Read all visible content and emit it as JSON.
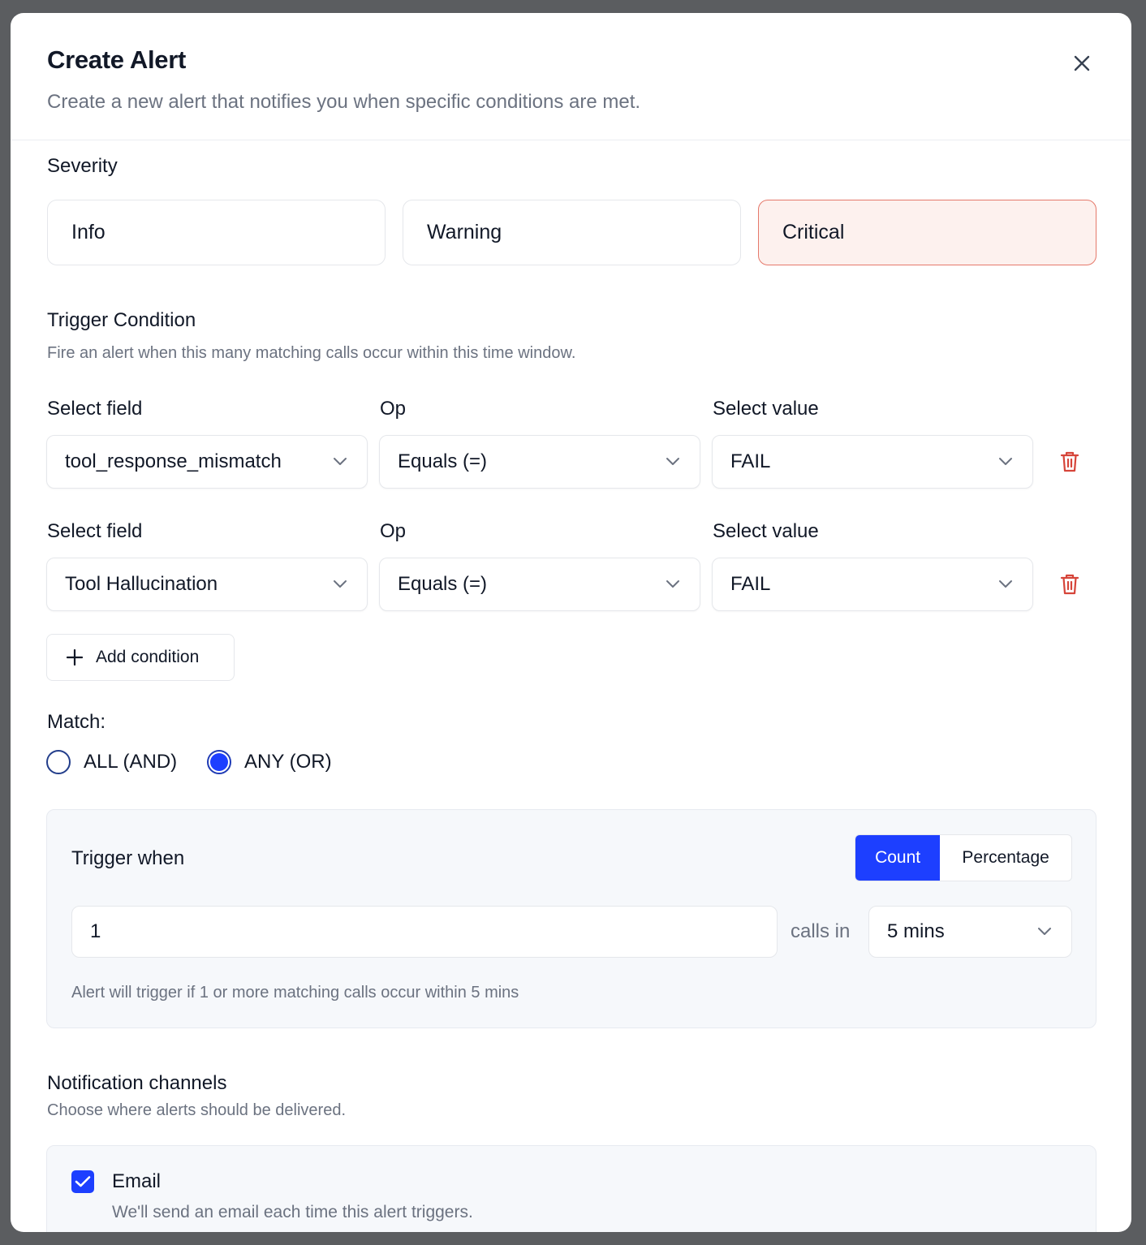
{
  "dialog": {
    "title": "Create Alert",
    "subtitle": "Create a new alert that notifies you when specific conditions are met."
  },
  "severity": {
    "label": "Severity",
    "options": [
      "Info",
      "Warning",
      "Critical"
    ],
    "selected": "Critical",
    "selected_bg": "#fdf1ee",
    "selected_border": "#e5796b"
  },
  "trigger_condition": {
    "title": "Trigger Condition",
    "description": "Fire an alert when this many matching calls occur within this time window.",
    "conditions": [
      {
        "field_label": "Select field",
        "op_label": "Op",
        "value_label": "Select value",
        "field": "tool_response_mismatch",
        "op": "Equals (=)",
        "value": "FAIL"
      },
      {
        "field_label": "Select field",
        "op_label": "Op",
        "value_label": "Select value",
        "field": "Tool Hallucination",
        "op": "Equals (=)",
        "value": "FAIL"
      }
    ],
    "add_condition_label": "Add condition"
  },
  "match": {
    "label": "Match:",
    "options": [
      "ALL (AND)",
      "ANY (OR)"
    ],
    "selected": "ANY (OR)"
  },
  "trigger_when": {
    "title": "Trigger when",
    "modes": [
      "Count",
      "Percentage"
    ],
    "selected_mode": "Count",
    "threshold_value": "1",
    "calls_in_label": "calls in",
    "window": "5 mins",
    "summary": "Alert will trigger if 1 or more matching calls occur within 5 mins"
  },
  "notifications": {
    "title": "Notification channels",
    "description": "Choose where alerts should be delivered.",
    "channels": [
      {
        "label": "Email",
        "description": "We'll send an email each time this alert triggers.",
        "checked": true
      }
    ]
  },
  "colors": {
    "accent": "#1d3fff",
    "danger": "#d6453a"
  },
  "icons": {
    "close": "close-icon",
    "chevron": "chevron-down-icon",
    "trash": "trash-icon",
    "plus": "plus-icon",
    "check": "check-icon"
  }
}
